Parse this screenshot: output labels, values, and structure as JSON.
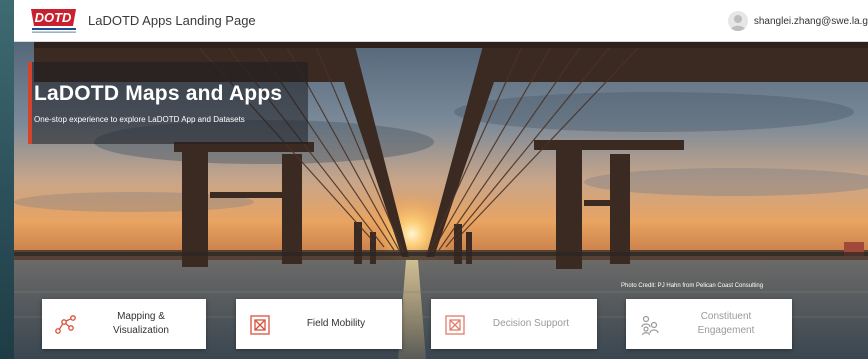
{
  "app": {
    "title": "LaDOTD Apps Landing Page",
    "logo_text": "DOTD",
    "user": {
      "name": "shanglei.zhang@swe.la.g",
      "avatar_icon": "user-avatar-icon"
    }
  },
  "hero": {
    "title": "LaDOTD Maps and Apps",
    "subtitle": "One-stop experience to explore LaDOTD App and Datasets",
    "credit": "Photo Credit: PJ Hahn from Pelican Coast Consulting"
  },
  "cards": [
    {
      "label_line1": "Mapping &",
      "label_line2": "Visualization",
      "icon": "network-nodes-icon",
      "state": "active"
    },
    {
      "label_line1": "Field Mobility",
      "label_line2": "",
      "icon": "grid-box-icon",
      "state": "active"
    },
    {
      "label_line1": "Decision Support",
      "label_line2": "",
      "icon": "grid-box-icon",
      "state": "muted"
    },
    {
      "label_line1": "Constituent",
      "label_line2": "Engagement",
      "icon": "people-group-icon",
      "state": "muted"
    }
  ],
  "colors": {
    "accent": "#d4432b",
    "icon_red": "#d9503a",
    "logo_red": "#c8202f",
    "logo_blue": "#1d4f91",
    "muted_text": "#9a9a9a"
  }
}
